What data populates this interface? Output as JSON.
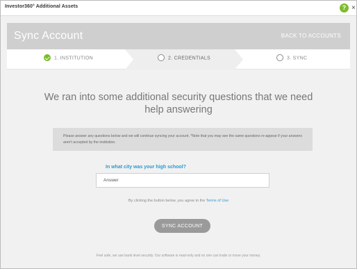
{
  "window": {
    "title": "Investor360° Additional Assets",
    "help_glyph": "?",
    "close_glyph": "×"
  },
  "header": {
    "title": "Sync Account",
    "back_link": "BACK TO ACCOUNTS"
  },
  "steps": [
    {
      "label": "1. INSTITUTION",
      "state": "complete"
    },
    {
      "label": "2. CREDENTIALS",
      "state": "active"
    },
    {
      "label": "3. SYNC",
      "state": "pending"
    }
  ],
  "main": {
    "title": "We ran into some additional security questions that we need help answering",
    "notice": "Please answer any questions below and we will continue syncing your account. *Note that you may see the same questions re-appear if your answers aren't accepted by the institution.",
    "question": "In what city was your high school?",
    "answer_placeholder": "Answer",
    "agree_text": "By clicking the button below, you agree to the",
    "terms_link": "Terms of Use",
    "sync_button": "SYNC ACCOUNT",
    "footer": "Feel safe, we use bank level security. Our software is read-only and no one can trade or move your money."
  },
  "colors": {
    "accent_green": "#7dbb2d",
    "link_blue": "#2b9ad1",
    "header_gray": "#cfcfcf",
    "button_gray": "#9a9a9a"
  }
}
